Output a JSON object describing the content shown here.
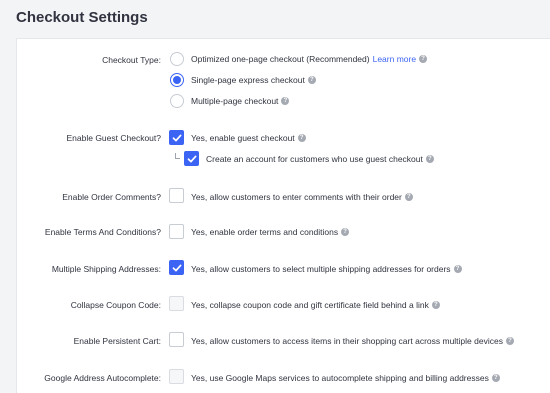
{
  "page": {
    "title": "Checkout Settings"
  },
  "checkout_type": {
    "label": "Checkout Type:",
    "options": [
      {
        "text": "Optimized one-page checkout (Recommended)",
        "link": "Learn more",
        "selected": false
      },
      {
        "text": "Single-page express checkout",
        "selected": true
      },
      {
        "text": "Multiple-page checkout",
        "selected": false
      }
    ]
  },
  "guest_checkout": {
    "label": "Enable Guest Checkout?",
    "text": "Yes, enable guest checkout",
    "checked": true,
    "sub": {
      "text": "Create an account for customers who use guest checkout",
      "checked": true
    }
  },
  "order_comments": {
    "label": "Enable Order Comments?",
    "text": "Yes, allow customers to enter comments with their order",
    "checked": false
  },
  "terms": {
    "label": "Enable Terms And Conditions?",
    "text": "Yes, enable order terms and conditions",
    "checked": false
  },
  "multi_shipping": {
    "label": "Multiple Shipping Addresses:",
    "text": "Yes, allow customers to select multiple shipping addresses for orders",
    "checked": true
  },
  "coupon": {
    "label": "Collapse Coupon Code:",
    "text": "Yes, collapse coupon code and gift certificate field behind a link",
    "checked": false,
    "disabled": true
  },
  "persistent_cart": {
    "label": "Enable Persistent Cart:",
    "text": "Yes, allow customers to access items in their shopping cart across multiple devices",
    "checked": false
  },
  "google_autocomplete": {
    "label": "Google Address Autocomplete:",
    "text": "Yes, use Google Maps services to autocomplete shipping and billing addresses",
    "checked": false,
    "disabled": true
  },
  "help_glyph": "?",
  "colors": {
    "accent": "#3c64f4",
    "text": "#313440",
    "help": "#a5a9b2"
  }
}
